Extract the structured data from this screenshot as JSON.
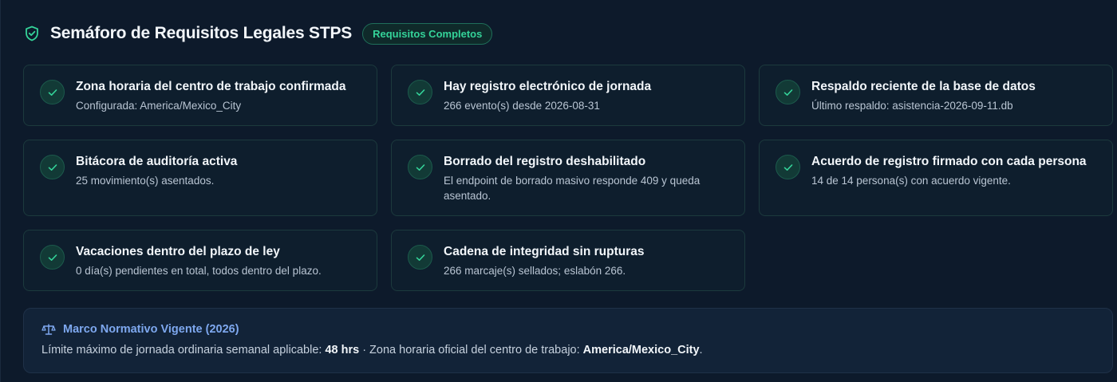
{
  "header": {
    "title": "Semáforo de Requisitos Legales STPS",
    "badge": "Requisitos Completos",
    "icon": "shield-check-icon"
  },
  "colors": {
    "accent_green": "#34d399",
    "accent_blue": "#7ea8ef",
    "background": "#0d1a2b"
  },
  "requirements": [
    {
      "title": "Zona horaria del centro de trabajo confirmada",
      "desc": "Configurada: America/Mexico_City",
      "status": "ok"
    },
    {
      "title": "Hay registro electrónico de jornada",
      "desc": "266 evento(s) desde 2026-08-31",
      "status": "ok"
    },
    {
      "title": "Respaldo reciente de la base de datos",
      "desc": "Último respaldo: asistencia-2026-09-11.db",
      "status": "ok"
    },
    {
      "title": "Bitácora de auditoría activa",
      "desc": "25 movimiento(s) asentados.",
      "status": "ok"
    },
    {
      "title": "Borrado del registro deshabilitado",
      "desc": "El endpoint de borrado masivo responde 409 y queda asentado.",
      "status": "ok"
    },
    {
      "title": "Acuerdo de registro firmado con cada persona",
      "desc": "14 de 14 persona(s) con acuerdo vigente.",
      "status": "ok"
    },
    {
      "title": "Vacaciones dentro del plazo de ley",
      "desc": "0 día(s) pendientes en total, todos dentro del plazo.",
      "status": "ok"
    },
    {
      "title": "Cadena de integridad sin rupturas",
      "desc": "266 marcaje(s) sellados; eslabón 266.",
      "status": "ok"
    }
  ],
  "marco": {
    "title": "Marco Normativo Vigente (2026)",
    "icon": "scale-icon",
    "line_prefix": "Límite máximo de jornada ordinaria semanal aplicable: ",
    "hours": "48 hrs",
    "line_middle": " · Zona horaria oficial del centro de trabajo: ",
    "timezone": "America/Mexico_City",
    "line_suffix": "."
  }
}
